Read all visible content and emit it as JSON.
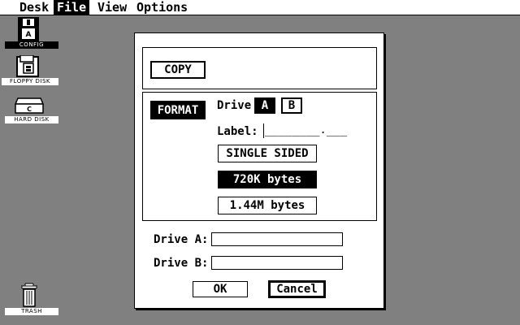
{
  "menubar": {
    "items": [
      {
        "label": "Desk"
      },
      {
        "label": "File"
      },
      {
        "label": "View"
      },
      {
        "label": "Options"
      }
    ]
  },
  "desktop": {
    "icons": [
      {
        "label": "CONFIG"
      },
      {
        "label": "FLOPPY DISK"
      },
      {
        "label": "HARD DISK"
      },
      {
        "label": "TRASH"
      }
    ]
  },
  "dialog": {
    "copy_label": "COPY",
    "format_label": "FORMAT",
    "drive_label": "Drive",
    "drive_a": "A",
    "drive_b": "B",
    "disk_label_caption": "Label:",
    "disk_label_mask": "________.___",
    "single_sided_label": "SINGLE SIDED",
    "capacity_720_label": "720K bytes",
    "capacity_144_label": "1.44M bytes",
    "drive_a_field_caption": "Drive A:",
    "drive_b_field_caption": "Drive B:",
    "drive_a_value": "",
    "drive_b_value": "",
    "ok_label": "OK",
    "cancel_label": "Cancel"
  }
}
